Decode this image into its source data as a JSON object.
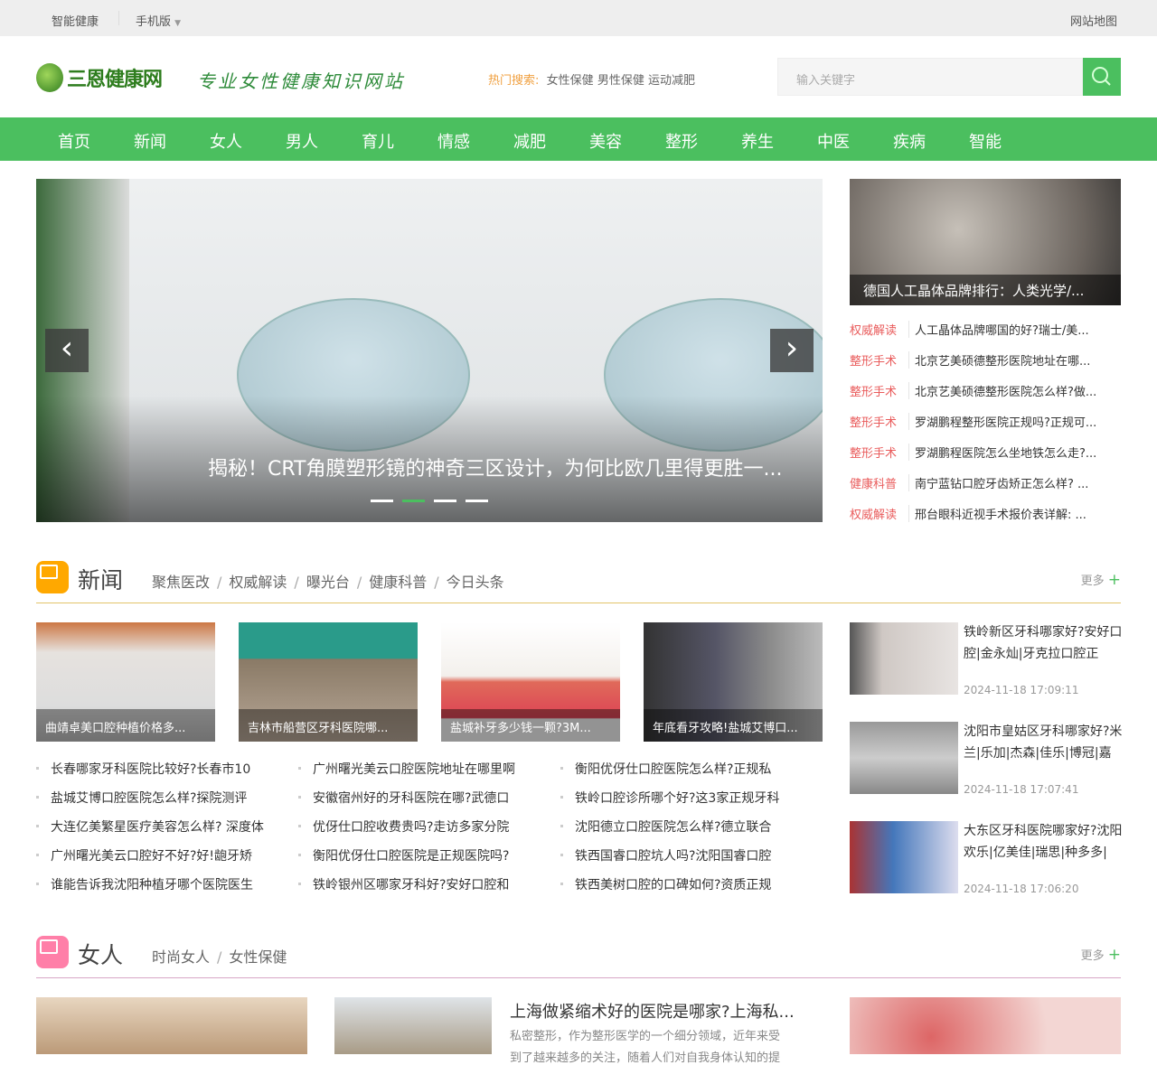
{
  "topbar": {
    "left": "智能健康",
    "mobile": "手机版",
    "sitemap": "网站地图"
  },
  "header": {
    "logo": "三恩健康网",
    "slogan": "专业女性健康知识网站",
    "hot_label": "热门搜索:",
    "hot_terms": [
      "女性保健",
      "男性保健",
      "运动减肥"
    ],
    "search_placeholder": "输入关键字"
  },
  "nav": [
    "首页",
    "新闻",
    "女人",
    "男人",
    "育儿",
    "情感",
    "减肥",
    "美容",
    "整形",
    "养生",
    "中医",
    "疾病",
    "智能"
  ],
  "slider": {
    "caption": "揭秘！CRT角膜塑形镜的神奇三区设计，为何比欧几里得更胜一...",
    "prev": "‹",
    "next": "›",
    "active_slide": 2,
    "slide_count": 4
  },
  "featured": {
    "caption": "德国人工晶体品牌排行：人类光学/..."
  },
  "right_list": [
    {
      "tag": "权威解读",
      "title": "人工晶体品牌哪国的好?瑞士/美..."
    },
    {
      "tag": "整形手术",
      "title": "北京艺美硕德整形医院地址在哪..."
    },
    {
      "tag": "整形手术",
      "title": "北京艺美硕德整形医院怎么样?做..."
    },
    {
      "tag": "整形手术",
      "title": "罗湖鹏程整形医院正规吗?正规可..."
    },
    {
      "tag": "整形手术",
      "title": "罗湖鹏程医院怎么坐地铁怎么走?..."
    },
    {
      "tag": "健康科普",
      "title": "南宁蓝钻口腔牙齿矫正怎么样? ..."
    },
    {
      "tag": "权威解读",
      "title": "邢台眼科近视手术报价表详解: ..."
    }
  ],
  "news": {
    "title": "新闻",
    "subs": [
      "聚焦医改",
      "权威解读",
      "曝光台",
      "健康科普",
      "今日头条"
    ],
    "more": "更多",
    "cards": [
      "曲靖卓美口腔种植价格多...",
      "吉林市船营区牙科医院哪...",
      "盐城补牙多少钱一颗?3M...",
      "年底看牙攻略!盐城艾博口..."
    ],
    "lists": [
      [
        "长春哪家牙科医院比较好?长春市10",
        "盐城艾博口腔医院怎么样?探院测评",
        "大连亿美繁星医疗美容怎么样? 深度体",
        "广州曙光美云口腔好不好?好!龅牙矫",
        "谁能告诉我沈阳种植牙哪个医院医生"
      ],
      [
        "广州曙光美云口腔医院地址在哪里啊",
        "安徽宿州好的牙科医院在哪?武德口",
        "优伢仕口腔收费贵吗?走访多家分院",
        "衡阳优伢仕口腔医院是正规医院吗?",
        "铁岭银州区哪家牙科好?安好口腔和"
      ],
      [
        "衡阳优伢仕口腔医院怎么样?正规私",
        "铁岭口腔诊所哪个好?这3家正规牙科",
        "沈阳德立口腔医院怎么样?德立联合",
        "铁西国睿口腔坑人吗?沈阳国睿口腔",
        "铁西美树口腔的口碑如何?资质正规"
      ]
    ],
    "side": [
      {
        "title": "铁岭新区牙科哪家好?安好口腔|金永灿|牙克拉口腔正",
        "date": "2024-11-18 17:09:11"
      },
      {
        "title": "沈阳市皇姑区牙科哪家好?米兰|乐加|杰森|佳乐|博冠|嘉",
        "date": "2024-11-18 17:07:41"
      },
      {
        "title": "大东区牙科医院哪家好?沈阳欢乐|亿美佳|瑞思|种多多|",
        "date": "2024-11-18 17:06:20"
      }
    ]
  },
  "women": {
    "title": "女人",
    "subs": [
      "时尚女人",
      "女性保健"
    ],
    "more": "更多",
    "article": {
      "title": "上海做紧缩术好的医院是哪家?上海私...",
      "excerpt1": "私密整形，作为整形医学的一个细分领域，近年来受",
      "excerpt2": "到了越来越多的关注，随着人们对自我身体认知的提"
    }
  },
  "colors": {
    "green": "#4bbf5f",
    "news_accent": "#ffa800",
    "women_accent": "#ff7fa8",
    "tag_red": "#e95b5b"
  }
}
